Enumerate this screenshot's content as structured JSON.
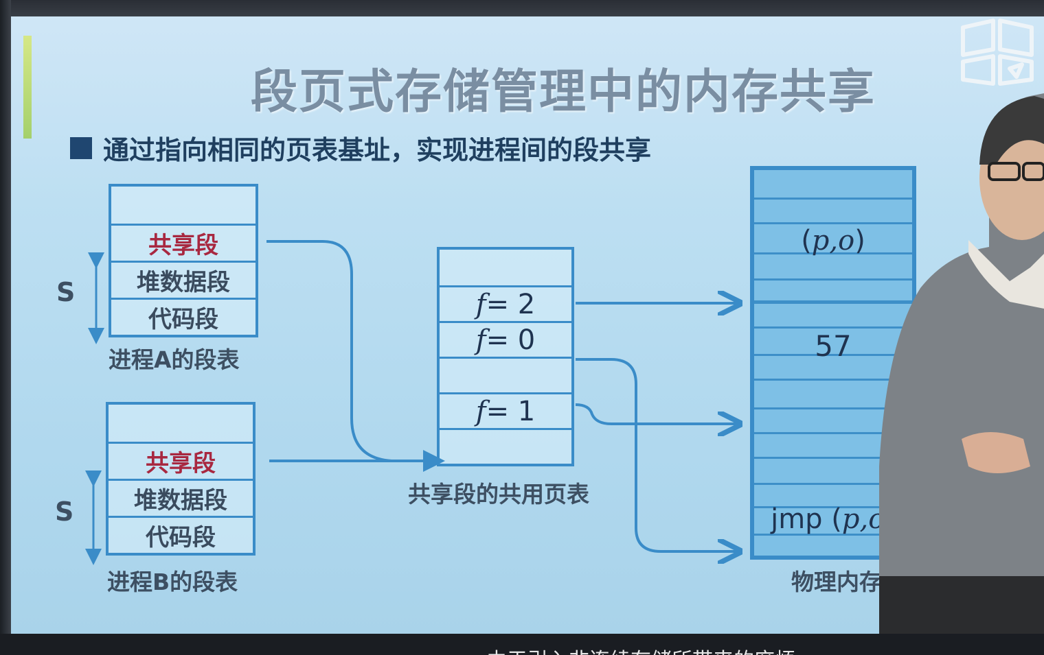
{
  "title": "段页式存储管理中的内存共享",
  "bullet": "通过指向相同的页表基址，实现进程间的段共享",
  "process_a": {
    "caption": "进程A的段表",
    "rows": [
      "",
      "共享段",
      "堆数据段",
      "代码段"
    ],
    "s_label": "S"
  },
  "process_b": {
    "caption": "进程B的段表",
    "rows": [
      "",
      "共享段",
      "堆数据段",
      "代码段"
    ],
    "s_label": "S"
  },
  "page_table": {
    "caption": "共享段的共用页表",
    "rows": [
      {
        "f": "",
        "eq": ""
      },
      {
        "f": "f",
        "eq": " = 2"
      },
      {
        "f": "f",
        "eq": " = 0"
      },
      {
        "f": "",
        "eq": ""
      },
      {
        "f": "f",
        "eq": " = 1"
      },
      {
        "f": "",
        "eq": ""
      }
    ]
  },
  "memory": {
    "caption": "物理内存",
    "po_open": "(",
    "po_var": "p,o",
    "po_close": ")",
    "value_57": "57",
    "jmp": "jmp (",
    "jmp_var": "p,o",
    "jmp_close": ")"
  },
  "subtitle": "由于引入非连续存储所带来的麻烦",
  "colors": {
    "accent": "#3a8cc8",
    "shared_text": "#a82840",
    "arrow": "#3a8cc8"
  }
}
